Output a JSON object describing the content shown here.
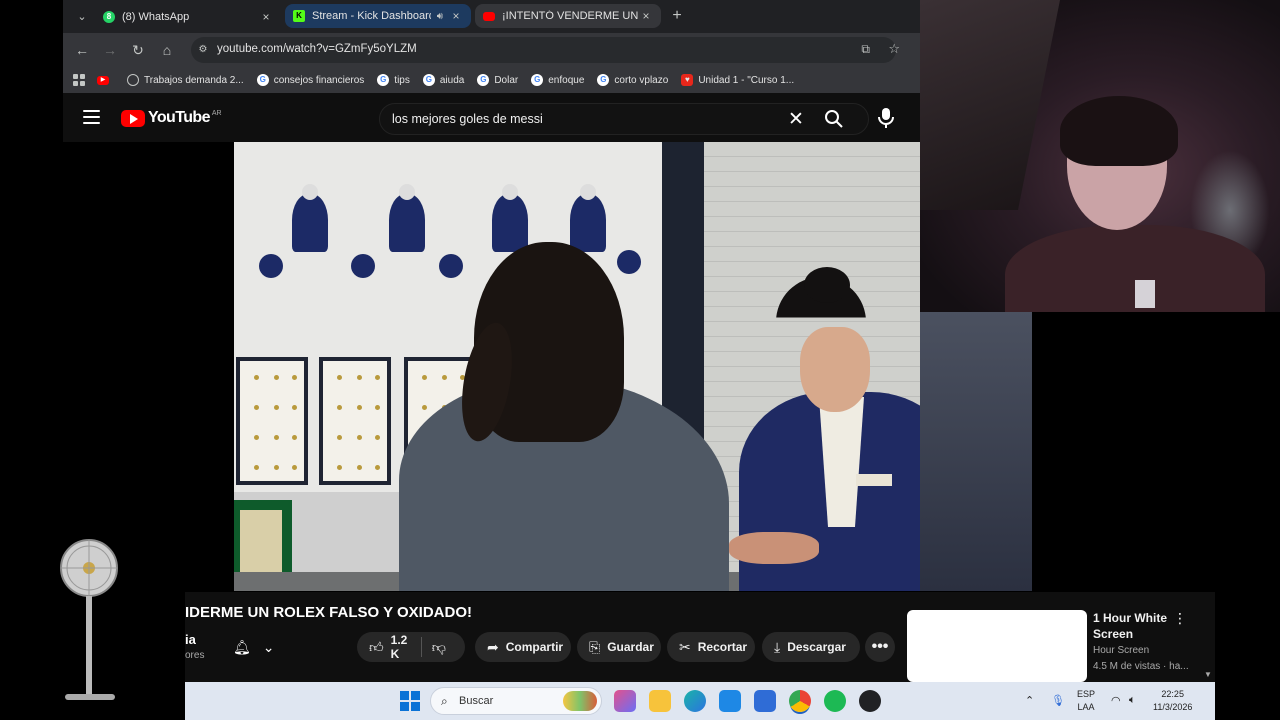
{
  "browser": {
    "tabs": [
      {
        "title": "(8) WhatsApp",
        "close": "×"
      },
      {
        "title": "Stream - Kick Dashboard",
        "close": "×"
      },
      {
        "title": "¡INTENTÓ VENDERME UN ROLE",
        "close": "×"
      }
    ],
    "new_tab": "+",
    "url": "youtube.com/watch?v=GZmFy5oYLZM",
    "bookmarks": [
      {
        "label": "",
        "icon": "youtube-icon"
      },
      {
        "label": "Trabajos demanda 2...",
        "icon": "globe-icon"
      },
      {
        "label": "consejos financieros",
        "icon": "google-icon"
      },
      {
        "label": "tips",
        "icon": "google-icon"
      },
      {
        "label": "aiuda",
        "icon": "google-icon"
      },
      {
        "label": "Dolar",
        "icon": "google-icon"
      },
      {
        "label": "enfoque",
        "icon": "google-icon"
      },
      {
        "label": "corto vplazo",
        "icon": "google-icon"
      },
      {
        "label": "Unidad 1 - \"Curso 1...",
        "icon": "course-icon"
      }
    ]
  },
  "youtube": {
    "logo": "YouTube",
    "country": "AR",
    "search_query": "los mejores goles de messi"
  },
  "video": {
    "title": "IDERME UN ROLEX FALSO Y OXIDADO!",
    "channel_name": "ia",
    "channel_subs": "ores",
    "like_count": "1.2 K",
    "share": "Compartir",
    "save": "Guardar",
    "clip": "Recortar",
    "download": "Descargar"
  },
  "recommendation": {
    "title": "1 Hour White Screen",
    "channel": "Hour Screen",
    "meta": "4.5 M de vistas · ha..."
  },
  "taskbar": {
    "search": "Buscar",
    "lang_top": "ESP",
    "lang_bottom": "LAA",
    "time": "22:25",
    "date": "11/3/2026"
  },
  "colors": {
    "youtube_red": "#ff0000",
    "youtube_bg": "#0f0f0f",
    "chrome_bg": "#202124",
    "chrome_toolbar": "#35363a",
    "taskbar_bg": "#dfe6f1"
  }
}
